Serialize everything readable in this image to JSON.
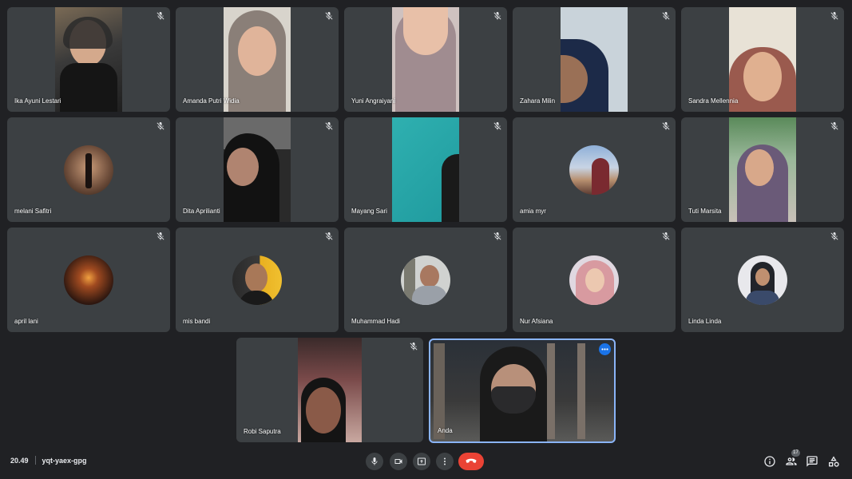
{
  "participants": [
    {
      "name": "Ika Ayuni Lestari"
    },
    {
      "name": "Amanda Putri Widia"
    },
    {
      "name": "Yuni Angraiyani"
    },
    {
      "name": "Zahara Milin"
    },
    {
      "name": "Sandra Mellennia"
    },
    {
      "name": "melani Safitri"
    },
    {
      "name": "Dita Aprilianti"
    },
    {
      "name": "Mayang Sari"
    },
    {
      "name": "amia myr"
    },
    {
      "name": "Tuti Marsita"
    },
    {
      "name": "april lani"
    },
    {
      "name": "mis bandi"
    },
    {
      "name": "Muhammad Hadi"
    },
    {
      "name": "Nur Afsiana"
    },
    {
      "name": "Linda Linda"
    },
    {
      "name": "Robi Saputra"
    },
    {
      "name": "Anda"
    }
  ],
  "meeting": {
    "time": "20.49",
    "code": "yqt-yaex-gpg",
    "participant_count": "17"
  },
  "colors": {
    "background": "#202124",
    "tile": "#3c4043",
    "end_call": "#ea4335",
    "self_border": "#8ab4f8",
    "menu_dot": "#1a73e8"
  },
  "icons": {
    "mute": "mic-off-icon",
    "mic": "mic-icon",
    "camera": "camera-icon",
    "present": "present-screen-icon",
    "more": "more-vert-icon",
    "end": "hang-up-icon",
    "info": "info-icon",
    "people": "people-icon",
    "chat": "chat-icon",
    "activities": "activities-icon"
  }
}
